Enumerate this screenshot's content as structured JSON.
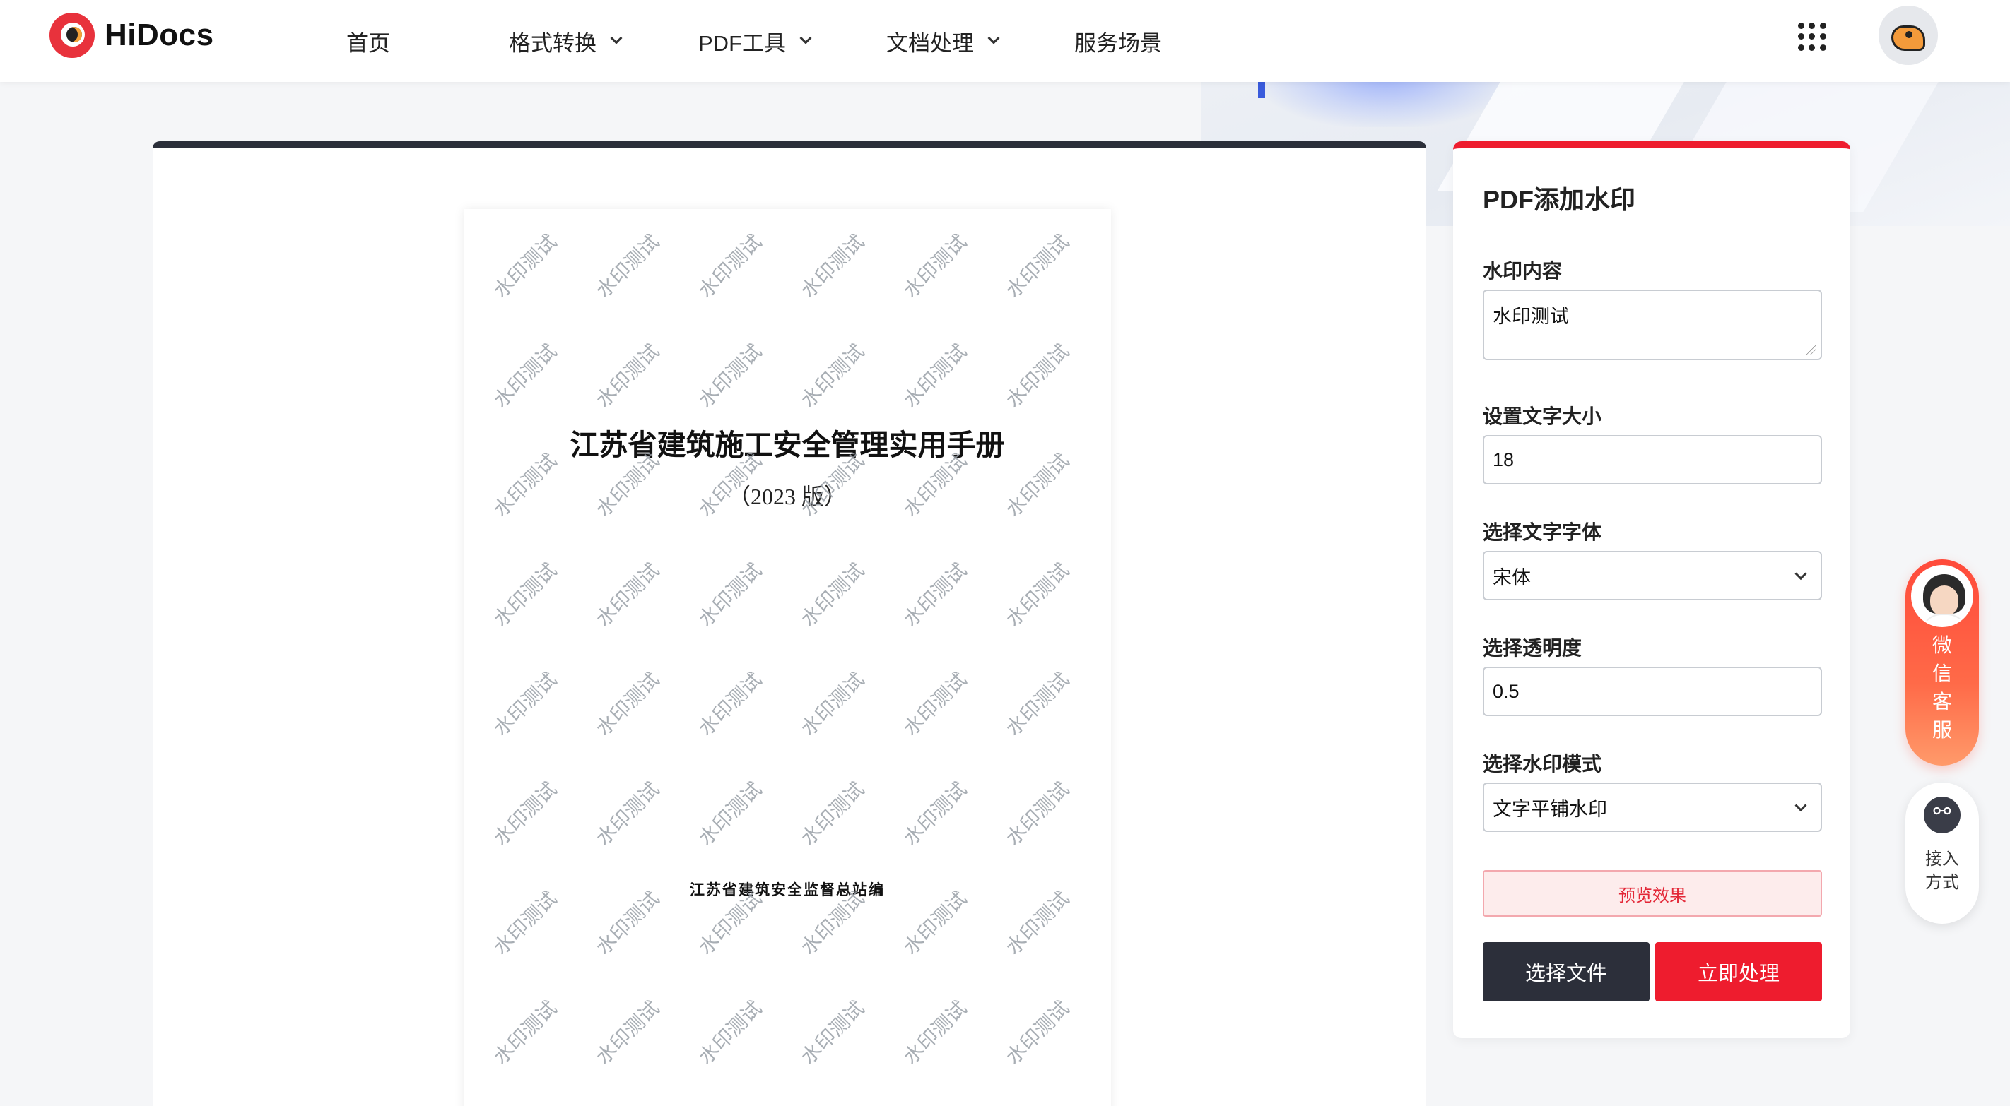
{
  "brand": {
    "name": "HiDocs"
  },
  "nav": [
    {
      "label": "首页",
      "has_dropdown": false
    },
    {
      "label": "格式转换",
      "has_dropdown": true
    },
    {
      "label": "PDF工具",
      "has_dropdown": true
    },
    {
      "label": "文档处理",
      "has_dropdown": true
    },
    {
      "label": "服务场景",
      "has_dropdown": false
    }
  ],
  "document": {
    "title": "江苏省建筑施工安全管理实用手册",
    "subtitle": "（2023 版）",
    "footer": "江苏省建筑安全监督总站编",
    "watermark_text": "水印测试"
  },
  "settings": {
    "title": "PDF添加水印",
    "watermark_content_label": "水印内容",
    "watermark_content_value": "水印测试",
    "font_size_label": "设置文字大小",
    "font_size_value": "18",
    "font_family_label": "选择文字字体",
    "font_family_value": "宋体",
    "opacity_label": "选择透明度",
    "opacity_value": "0.5",
    "mode_label": "选择水印模式",
    "mode_value": "文字平铺水印",
    "preview_button": "预览效果",
    "choose_file_button": "选择文件",
    "process_button": "立即处理"
  },
  "floating": {
    "service_text": "微信客服",
    "access_text": "接入方式"
  },
  "colors": {
    "accent_red": "#ee1c2e",
    "dark": "#2c2f3a",
    "preview_bg": "#fdecec"
  }
}
